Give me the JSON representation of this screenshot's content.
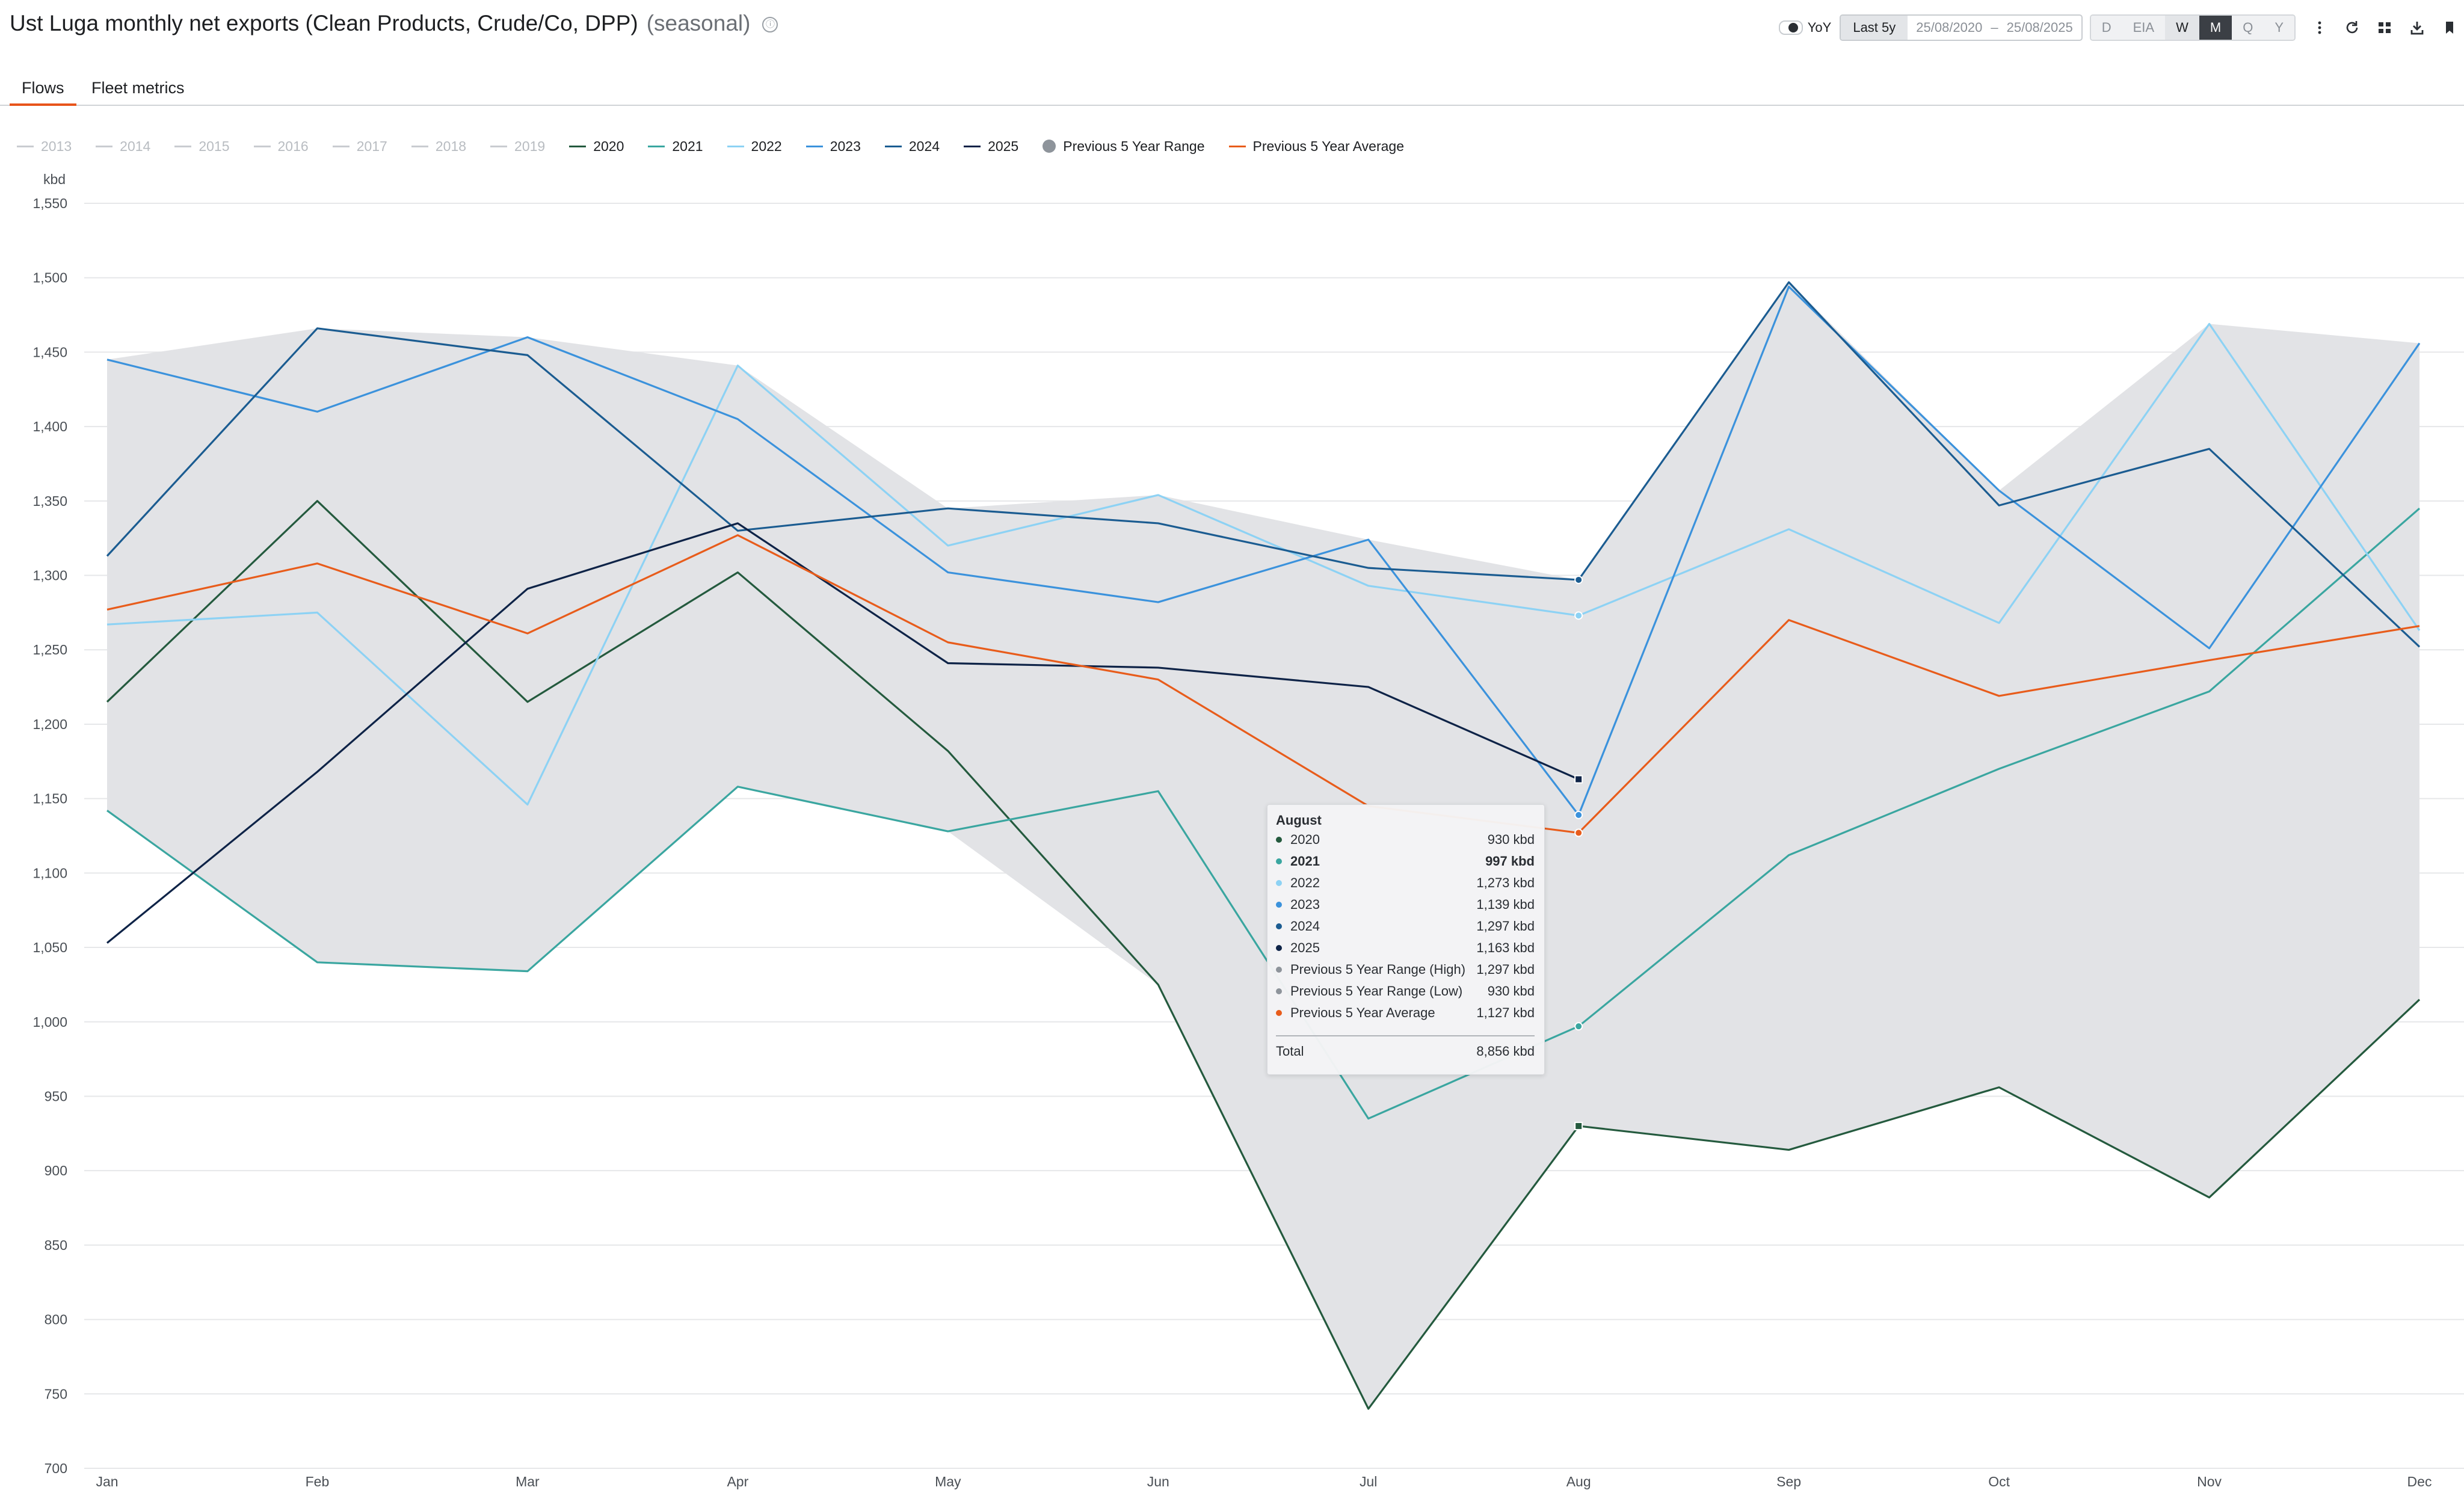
{
  "header": {
    "title": "Ust Luga monthly net exports (Clean Products, Crude/Co, DPP)",
    "subtitle": "(seasonal)",
    "info_icon": "ⓘ"
  },
  "toolbar": {
    "yoy_label": "YoY",
    "range_label": "Last 5y",
    "date_from": "25/08/2020",
    "date_sep": "–",
    "date_to": "25/08/2025",
    "periods": [
      "D",
      "EIA",
      "W",
      "M",
      "Q",
      "Y"
    ],
    "selected_period": "M",
    "icons": [
      "more-vertical-icon",
      "refresh-icon",
      "grid-icon",
      "download-icon",
      "bookmark-icon"
    ]
  },
  "tabs": [
    {
      "label": "Flows",
      "active": true
    },
    {
      "label": "Fleet metrics",
      "active": false
    }
  ],
  "legend": {
    "inactive_years": [
      "2013",
      "2014",
      "2015",
      "2016",
      "2017",
      "2018",
      "2019"
    ],
    "active": [
      {
        "label": "2020",
        "color": "#245a3e"
      },
      {
        "label": "2021",
        "color": "#3aa6a0"
      },
      {
        "label": "2022",
        "color": "#8dd2f4"
      },
      {
        "label": "2023",
        "color": "#3b92dc"
      },
      {
        "label": "2024",
        "color": "#1b5c91"
      },
      {
        "label": "2025",
        "color": "#0e2347"
      }
    ],
    "range_label": "Previous 5 Year Range",
    "range_color": "#8e949b",
    "average_label": "Previous 5 Year Average",
    "average_color": "#e85c1b"
  },
  "chart_data": {
    "type": "line",
    "ylabel": "kbd",
    "ylim": [
      700,
      1550
    ],
    "yticks": [
      700,
      750,
      800,
      850,
      900,
      950,
      1000,
      1050,
      1100,
      1150,
      1200,
      1250,
      1300,
      1350,
      1400,
      1450,
      1500,
      1550
    ],
    "categories": [
      "Jan",
      "Feb",
      "Mar",
      "Apr",
      "May",
      "Jun",
      "Jul",
      "Aug",
      "Sep",
      "Oct",
      "Nov",
      "Dec"
    ],
    "range": {
      "name": "Previous 5 Year Range",
      "high": [
        1445,
        1466,
        1460,
        1441,
        1345,
        1354,
        1324,
        1297,
        1497,
        1357,
        1469,
        1456
      ],
      "low": [
        1142,
        1040,
        1034,
        1158,
        1128,
        1025,
        740,
        930,
        914,
        956,
        882,
        1015
      ]
    },
    "series": [
      {
        "name": "2020",
        "color": "#245a3e",
        "values": [
          1215,
          1350,
          1215,
          1302,
          1182,
          1025,
          740,
          930,
          914,
          956,
          882,
          1015
        ]
      },
      {
        "name": "2021",
        "color": "#3aa6a0",
        "values": [
          1142,
          1040,
          1034,
          1158,
          1128,
          1155,
          935,
          997,
          1112,
          1170,
          1222,
          1345
        ]
      },
      {
        "name": "2022",
        "color": "#8dd2f4",
        "values": [
          1267,
          1275,
          1146,
          1441,
          1320,
          1354,
          1293,
          1273,
          1331,
          1268,
          1469,
          1263
        ]
      },
      {
        "name": "2023",
        "color": "#3b92dc",
        "values": [
          1445,
          1410,
          1460,
          1405,
          1302,
          1282,
          1324,
          1139,
          1494,
          1357,
          1251,
          1456
        ]
      },
      {
        "name": "2024",
        "color": "#1b5c91",
        "values": [
          1313,
          1466,
          1448,
          1330,
          1345,
          1335,
          1305,
          1297,
          1497,
          1347,
          1385,
          1252
        ]
      },
      {
        "name": "2025",
        "color": "#0e2347",
        "values": [
          1053,
          1168,
          1291,
          1335,
          1241,
          1238,
          1225,
          1163
        ]
      },
      {
        "name": "Previous 5 Year Average",
        "color": "#e85c1b",
        "values": [
          1277,
          1308,
          1261,
          1327,
          1255,
          1230,
          1145,
          1127,
          1270,
          1219,
          1243,
          1266
        ]
      }
    ]
  },
  "tooltip": {
    "title": "August",
    "rows": [
      {
        "label": "2020",
        "value": "930 kbd",
        "color": "#245a3e",
        "bold": false
      },
      {
        "label": "2021",
        "value": "997 kbd",
        "color": "#3aa6a0",
        "bold": true
      },
      {
        "label": "2022",
        "value": "1,273 kbd",
        "color": "#8dd2f4",
        "bold": false
      },
      {
        "label": "2023",
        "value": "1,139 kbd",
        "color": "#3b92dc",
        "bold": false
      },
      {
        "label": "2024",
        "value": "1,297 kbd",
        "color": "#1b5c91",
        "bold": false
      },
      {
        "label": "2025",
        "value": "1,163 kbd",
        "color": "#0e2347",
        "bold": false
      },
      {
        "label": "Previous 5 Year Range (High)",
        "value": "1,297 kbd",
        "color": "#8e949b",
        "bold": false
      },
      {
        "label": "Previous 5 Year Range (Low)",
        "value": "930 kbd",
        "color": "#8e949b",
        "bold": false
      },
      {
        "label": "Previous 5 Year Average",
        "value": "1,127 kbd",
        "color": "#e85c1b",
        "bold": false
      }
    ],
    "total_label": "Total",
    "total_value": "8,856 kbd"
  }
}
